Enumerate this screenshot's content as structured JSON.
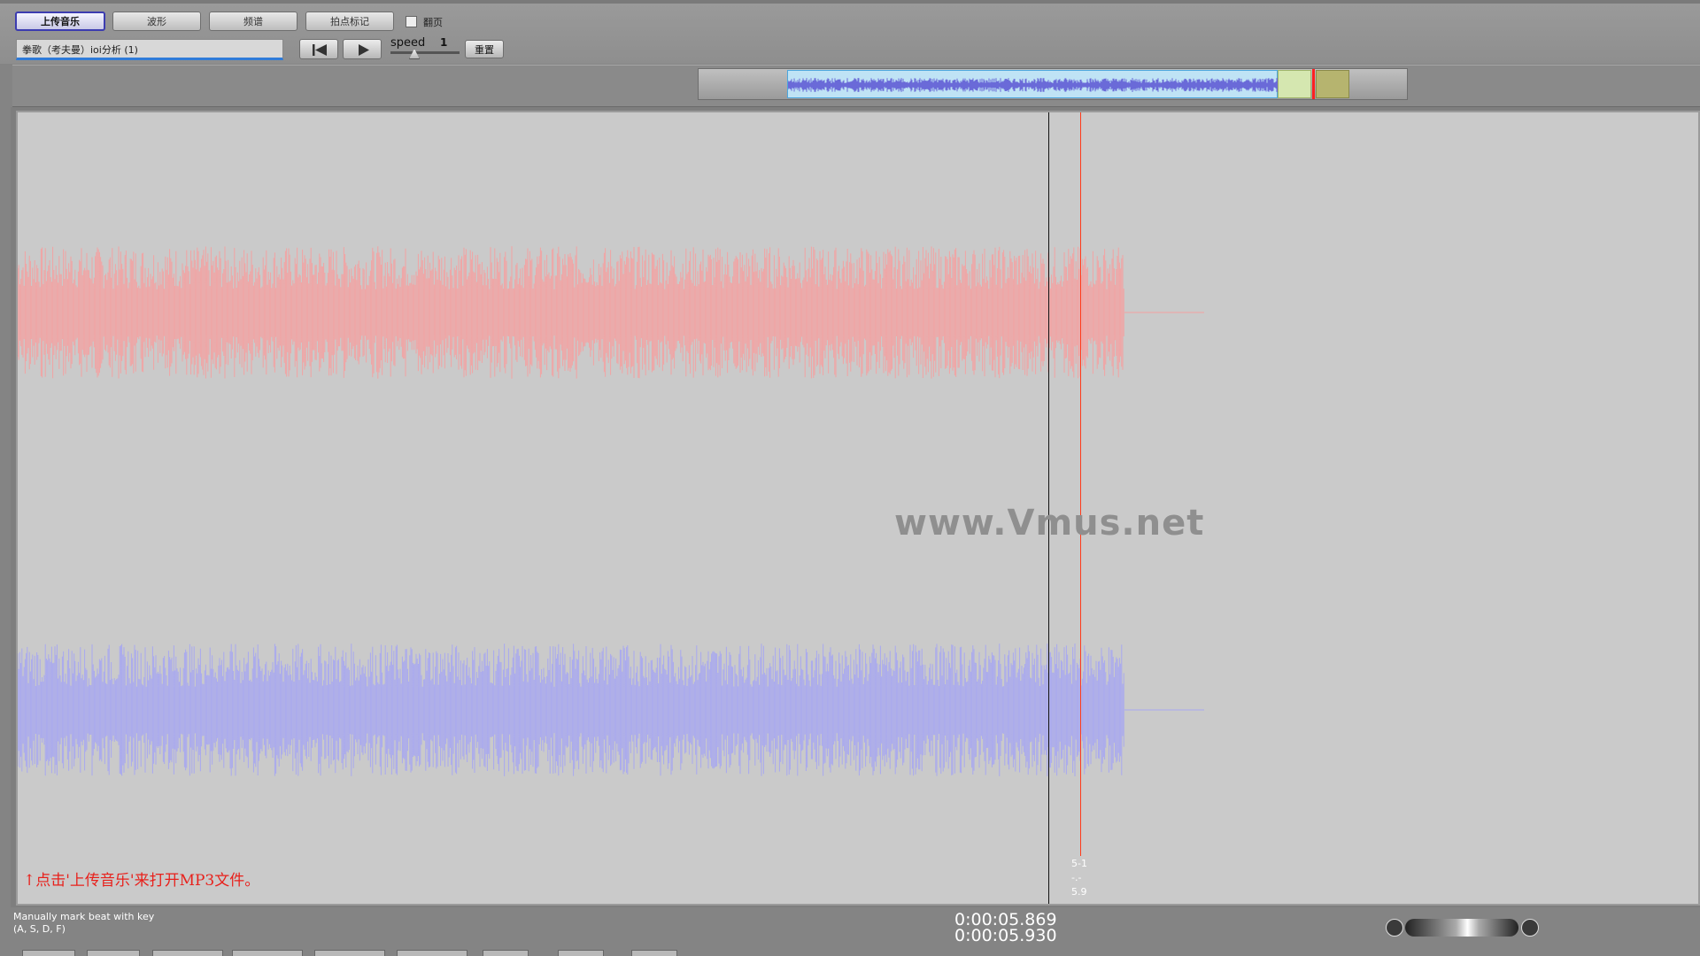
{
  "toolbar": {
    "buttons": [
      {
        "label": "上传音乐",
        "active": true
      },
      {
        "label": "波形",
        "active": false
      },
      {
        "label": "频谱",
        "active": false
      },
      {
        "label": "拍点标记",
        "active": false
      }
    ],
    "page_flip_label": "翻页",
    "page_flip_checked": false,
    "file_name": "拳歌（考夫曼）ioi分析 (1)",
    "speed_label": "speed",
    "speed_value": "1",
    "reset_label": "重置"
  },
  "waveform": {
    "watermark": "www.Vmus.net",
    "left_channel_color": "#f2a3a3",
    "right_channel_color": "#a8a8f0",
    "beat_line_color": "#ff3a1a",
    "beat_label_1": "5-1",
    "beat_label_2": "-.-",
    "beat_label_3": "5.9",
    "hint": "↑点击'上传音乐'来打开MP3文件。"
  },
  "status": {
    "manual_line1": "Manually mark beat with key",
    "manual_line2": "(A, S, D, F)",
    "time_current": "0:00:05.869",
    "time_beat": "0:00:05.930"
  }
}
